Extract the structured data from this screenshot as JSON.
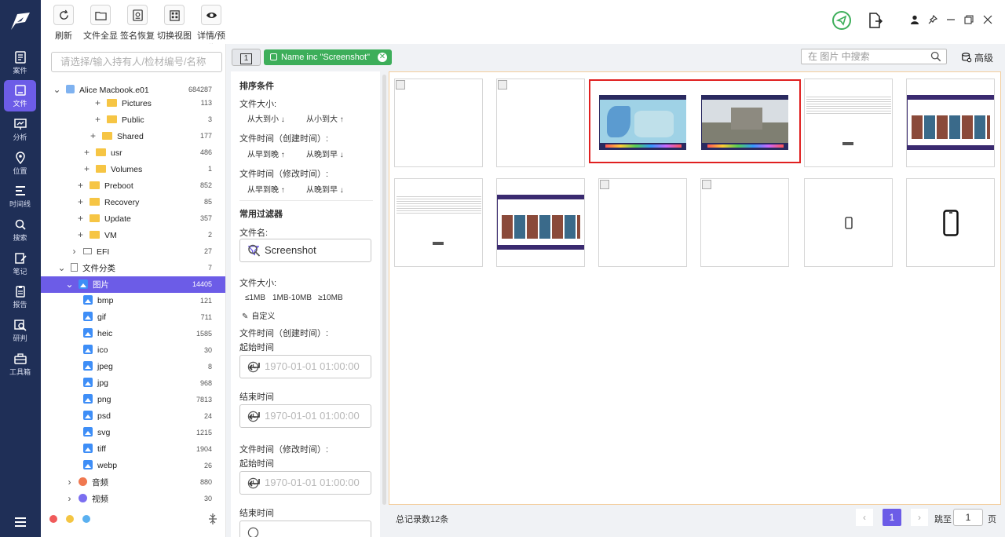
{
  "toolbar": {
    "buttons": [
      {
        "label": "刷新",
        "icon": "refresh-icon"
      },
      {
        "label": "文件全显",
        "icon": "folder-icon"
      },
      {
        "label": "签名恢复",
        "icon": "signature-icon"
      },
      {
        "label": "切换视图",
        "icon": "switch-view-icon"
      },
      {
        "label": "详情/预览",
        "icon": "eye-icon"
      }
    ]
  },
  "nav": {
    "items": [
      {
        "label": "案件",
        "icon": "case-icon"
      },
      {
        "label": "文件",
        "icon": "file-icon"
      },
      {
        "label": "分析",
        "icon": "analysis-icon"
      },
      {
        "label": "位置",
        "icon": "location-icon"
      },
      {
        "label": "时间线",
        "icon": "timeline-icon"
      },
      {
        "label": "搜索",
        "icon": "search-icon"
      },
      {
        "label": "笔记",
        "icon": "note-icon"
      },
      {
        "label": "报告",
        "icon": "report-icon"
      },
      {
        "label": "研判",
        "icon": "judge-icon"
      },
      {
        "label": "工具箱",
        "icon": "toolbox-icon"
      }
    ]
  },
  "tree": {
    "search_placeholder": "请选择/输入持有人/检材编号/名称",
    "rows": [
      {
        "label": "Alice Macbook.e01",
        "count": "684287"
      },
      {
        "label": "Pictures",
        "count": "113"
      },
      {
        "label": "Public",
        "count": "3"
      },
      {
        "label": "Shared",
        "count": "177"
      },
      {
        "label": "usr",
        "count": "486"
      },
      {
        "label": "Volumes",
        "count": "1"
      },
      {
        "label": "Preboot",
        "count": "852"
      },
      {
        "label": "Recovery",
        "count": "85"
      },
      {
        "label": "Update",
        "count": "357"
      },
      {
        "label": "VM",
        "count": "2"
      },
      {
        "label": "EFI",
        "count": "27"
      },
      {
        "label": "文件分类",
        "count": "7"
      },
      {
        "label": "图片",
        "count": "14405"
      },
      {
        "label": "bmp",
        "count": "121"
      },
      {
        "label": "gif",
        "count": "711"
      },
      {
        "label": "heic",
        "count": "1585"
      },
      {
        "label": "ico",
        "count": "30"
      },
      {
        "label": "jpeg",
        "count": "8"
      },
      {
        "label": "jpg",
        "count": "968"
      },
      {
        "label": "png",
        "count": "7813"
      },
      {
        "label": "psd",
        "count": "24"
      },
      {
        "label": "svg",
        "count": "1215"
      },
      {
        "label": "tiff",
        "count": "1904"
      },
      {
        "label": "webp",
        "count": "26"
      },
      {
        "label": "音频",
        "count": "880"
      },
      {
        "label": "视频",
        "count": "30"
      }
    ]
  },
  "tabs": {
    "index_label": "1",
    "filter_chip": "Name inc \"Screenshot\"",
    "search_placeholder": "在 图片 中搜索",
    "advanced_label": "高级"
  },
  "filters": {
    "sort_title": "排序条件",
    "size_label": "文件大小:",
    "size_desc": "从大到小",
    "size_asc": "从小到大",
    "ctime_label": "文件时间（创建时间）:",
    "early_first": "从早到晚",
    "late_first": "从晚到早",
    "mtime_label": "文件时间（修改时间）:",
    "common_title": "常用过滤器",
    "filename_label": "文件名:",
    "filename_value": "Screenshot",
    "size2_label": "文件大小:",
    "size_opts": [
      "≤1MB",
      "1MB-10MB",
      "≥10MB"
    ],
    "custom_label": "自定义",
    "ctime2_label": "文件时间（创建时间）:",
    "start_label": "起始时间",
    "end_label": "结束时间",
    "mtime2_label": "文件时间（修改时间）:",
    "start2_label": "起始时间",
    "end2_label": "结束时间",
    "time_placeholder": "1970-01-01 01:00:00"
  },
  "footer": {
    "total": "总记录数12条",
    "page": "1",
    "jump_label": "跳至",
    "jump_value": "1",
    "page_unit": "页"
  },
  "colors": {
    "nav_bg": "#1f2f57",
    "accent": "#6c5ce7",
    "chip_green": "#3dae5a",
    "selection_red": "#e02020"
  }
}
